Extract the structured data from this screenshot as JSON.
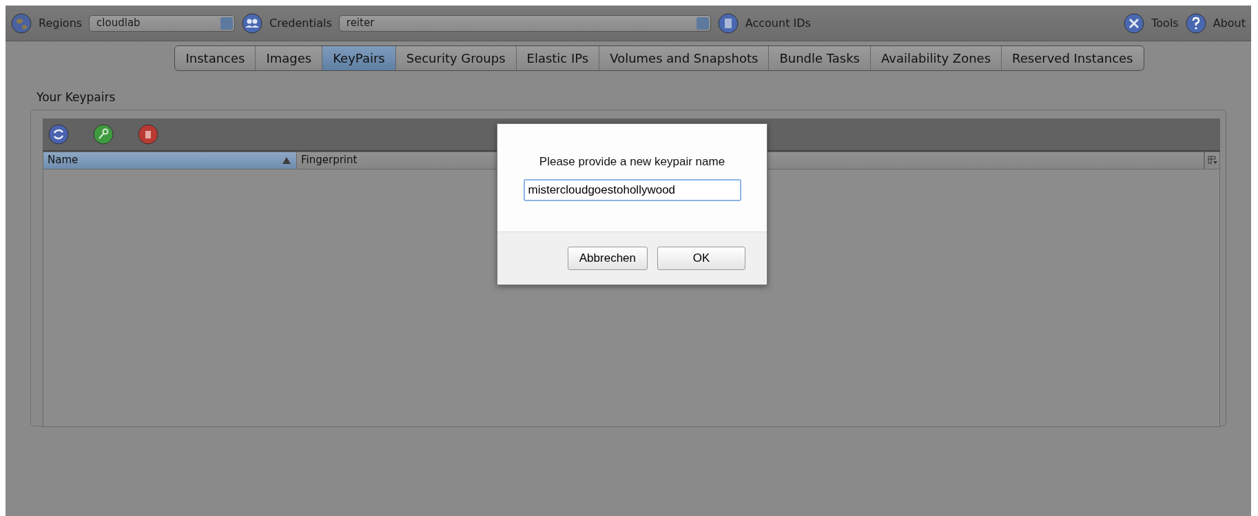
{
  "toolbar": {
    "regions": {
      "label": "Regions",
      "value": "cloudlab"
    },
    "credentials": {
      "label": "Credentials",
      "value": "reiter"
    },
    "account_ids": "Account IDs",
    "tools": "Tools",
    "about": "About"
  },
  "tabs": [
    {
      "label": "Instances",
      "selected": false
    },
    {
      "label": "Images",
      "selected": false
    },
    {
      "label": "KeyPairs",
      "selected": true
    },
    {
      "label": "Security Groups",
      "selected": false
    },
    {
      "label": "Elastic IPs",
      "selected": false
    },
    {
      "label": "Volumes and Snapshots",
      "selected": false
    },
    {
      "label": "Bundle Tasks",
      "selected": false
    },
    {
      "label": "Availability Zones",
      "selected": false
    },
    {
      "label": "Reserved Instances",
      "selected": false
    }
  ],
  "section_title": "Your Keypairs",
  "table": {
    "columns": [
      {
        "label": "Name",
        "sorted": true
      },
      {
        "label": "Fingerprint",
        "sorted": false
      }
    ]
  },
  "dialog": {
    "message": "Please provide a new keypair name",
    "value": "mistercloudgoestohollywood",
    "buttons": [
      {
        "label": "Abbrechen"
      },
      {
        "label": "OK"
      }
    ]
  }
}
